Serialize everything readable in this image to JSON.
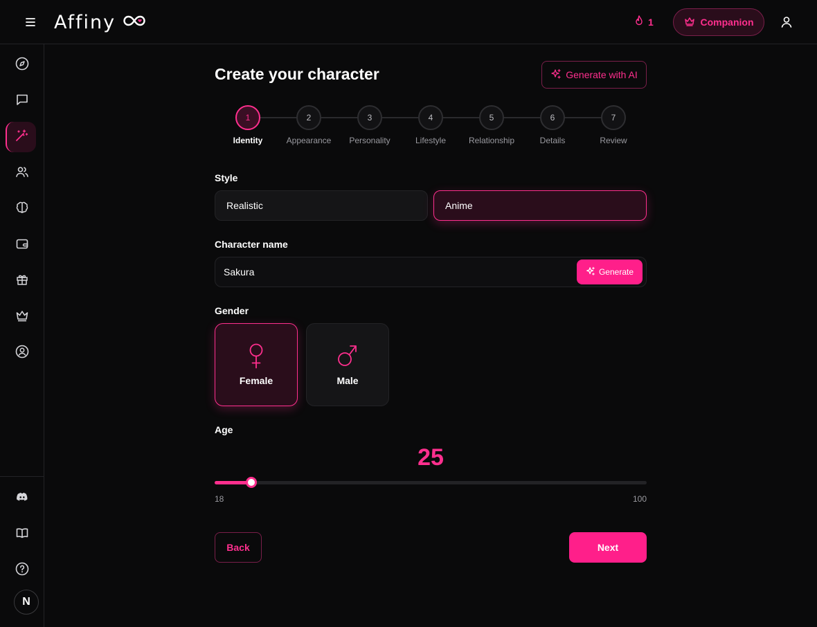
{
  "app": {
    "brand": "Affiny",
    "streak_count": "1",
    "companion_label": "Companion"
  },
  "sidebar": {
    "items": [
      {
        "icon": "compass-icon"
      },
      {
        "icon": "chat-icon"
      },
      {
        "icon": "magic-wand-icon",
        "active": true
      },
      {
        "icon": "users-icon"
      },
      {
        "icon": "brain-icon"
      },
      {
        "icon": "wallet-icon"
      },
      {
        "icon": "gift-icon"
      },
      {
        "icon": "crown-icon"
      },
      {
        "icon": "profile-circle-icon"
      }
    ],
    "bottom_items": [
      {
        "icon": "discord-icon"
      },
      {
        "icon": "book-icon"
      },
      {
        "icon": "help-icon"
      }
    ],
    "avatar_initial": "N"
  },
  "page": {
    "title": "Create your character",
    "generate_ai_label": "Generate with AI"
  },
  "stepper": {
    "current": 1,
    "steps": [
      {
        "number": "1",
        "label": "Identity"
      },
      {
        "number": "2",
        "label": "Appearance"
      },
      {
        "number": "3",
        "label": "Personality"
      },
      {
        "number": "4",
        "label": "Lifestyle"
      },
      {
        "number": "5",
        "label": "Relationship"
      },
      {
        "number": "6",
        "label": "Details"
      },
      {
        "number": "7",
        "label": "Review"
      }
    ]
  },
  "style": {
    "label": "Style",
    "options": [
      "Realistic",
      "Anime"
    ],
    "selected": "Anime"
  },
  "character_name": {
    "label": "Character name",
    "value": "Sakura",
    "generate_label": "Generate"
  },
  "gender": {
    "label": "Gender",
    "options": [
      "Female",
      "Male"
    ],
    "selected": "Female"
  },
  "age": {
    "label": "Age",
    "value": "25",
    "min": "18",
    "max": "100"
  },
  "actions": {
    "back_label": "Back",
    "next_label": "Next"
  },
  "colors": {
    "accent": "#ff2f8e",
    "background": "#0a0a0b",
    "card": "#151517"
  }
}
